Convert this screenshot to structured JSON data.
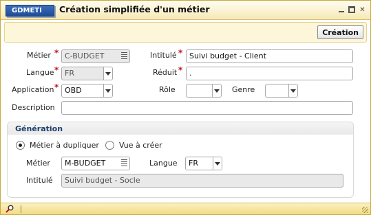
{
  "window": {
    "app_code": "GDMETI",
    "title": "Création simplifiée d'un métier"
  },
  "toolbar": {
    "create_label": "Création"
  },
  "form": {
    "metier": {
      "label": "Métier",
      "value": "C-BUDGET"
    },
    "intitule": {
      "label": "Intitulé",
      "value": "Suivi budget - Client"
    },
    "langue": {
      "label": "Langue",
      "value": "FR"
    },
    "reduit": {
      "label": "Réduit",
      "value": "."
    },
    "application": {
      "label": "Application",
      "value": "OBD"
    },
    "role": {
      "label": "Rôle",
      "value": ""
    },
    "genre": {
      "label": "Genre",
      "value": ""
    },
    "description": {
      "label": "Description",
      "value": ""
    }
  },
  "generation": {
    "title": "Génération",
    "radio_duplicate": "Métier à dupliquer",
    "radio_view": "Vue à créer",
    "selected": "duplicate",
    "metier": {
      "label": "Métier",
      "value": "M-BUDGET"
    },
    "langue": {
      "label": "Langue",
      "value": "FR"
    },
    "intitule": {
      "label": "Intitulé",
      "value": "Suivi budget - Socle"
    }
  },
  "required_marker": "*",
  "colors": {
    "accent": "#2a5aa6",
    "required": "#c0131b",
    "window_frame": "#f6e9b6"
  }
}
